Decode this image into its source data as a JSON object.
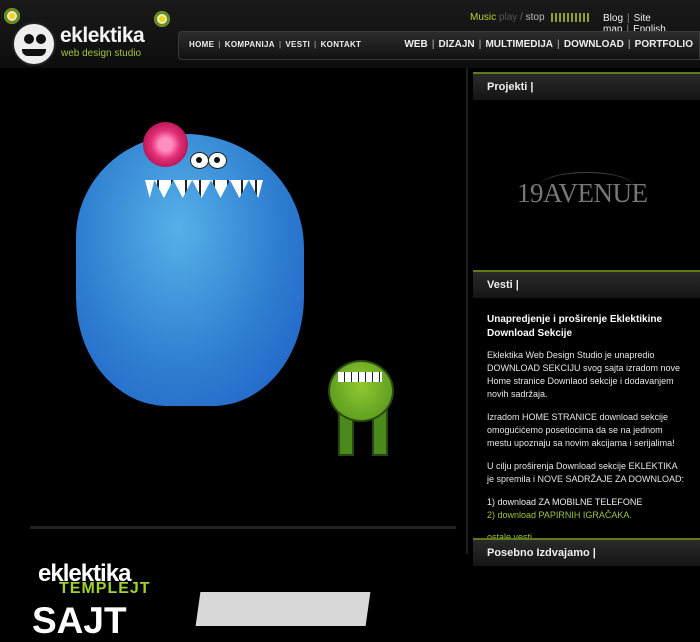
{
  "brand": {
    "name": "eklektika",
    "tagline": "web design studio"
  },
  "music": {
    "label": "Music",
    "play": "play",
    "sep": "/",
    "stop": "stop"
  },
  "util_links": [
    "Blog",
    "Site map",
    "English"
  ],
  "nav_left": [
    "HOME",
    "KOMPANIJA",
    "VESTI",
    "KONTAKT"
  ],
  "nav_right": [
    "WEB",
    "DIZAJN",
    "MULTIMEDIJA",
    "DOWNLOAD",
    "PORTFOLIO"
  ],
  "template_banner": {
    "line1": "eklektika",
    "line2": "TEMPLEJT",
    "line3": "SAJT"
  },
  "sidebar": {
    "projects": {
      "title": "Projekti |",
      "featured": "19AVENUE"
    },
    "news": {
      "title": "Vesti |",
      "headline": "Unapredjenje i proširenje Eklektikine Download Sekcije",
      "p1": "Eklektika Web Design Studio je unapredio DOWNLOAD SEKCIJU svog sajta izradom nove Home stranice Downlaod sekcije i dodavanjem novih sadržaja.",
      "p2": "Izradom HOME STRANICE download sekcije omogućićemo posetiocima da se na jednom mestu upoznaju sa novim akcijama i serijalima!",
      "p3": "U cilju proširenja Download sekcije EKLEKTIKA je spremila i NOVE SADRŽAJE ZA DOWNLOAD:",
      "list": [
        "1) download ZA MOBILNE TELEFONE",
        "2) download PAPIRNIH IGRAČAKA."
      ],
      "more": "ostale vesti"
    },
    "highlighted": {
      "title": "Posebno Izdvajamo |"
    }
  }
}
